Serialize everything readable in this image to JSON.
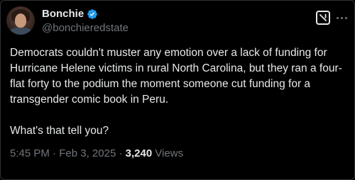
{
  "author": {
    "display_name": "Bonchie",
    "handle": "@bonchieredstate",
    "verified": true,
    "verified_color": "#1d9bf0"
  },
  "post": {
    "paragraph_1": "Democrats couldn't muster any emotion over a lack of funding for Hurricane Helene victims in rural North Carolina, but they ran a four-flat forty to the podium the moment someone cut funding for a transgender comic book in Peru.",
    "paragraph_2": "What's that tell you?"
  },
  "meta": {
    "time": "5:45 PM",
    "separator": "·",
    "date": "Feb 3, 2025",
    "views_count": "3,240",
    "views_label": "Views"
  },
  "icons": {
    "grok": "grok-icon",
    "more": "more-icon",
    "verified": "verified-badge-icon"
  },
  "colors": {
    "background": "#000000",
    "text": "#e7e9ea",
    "secondary_text": "#71767b"
  }
}
